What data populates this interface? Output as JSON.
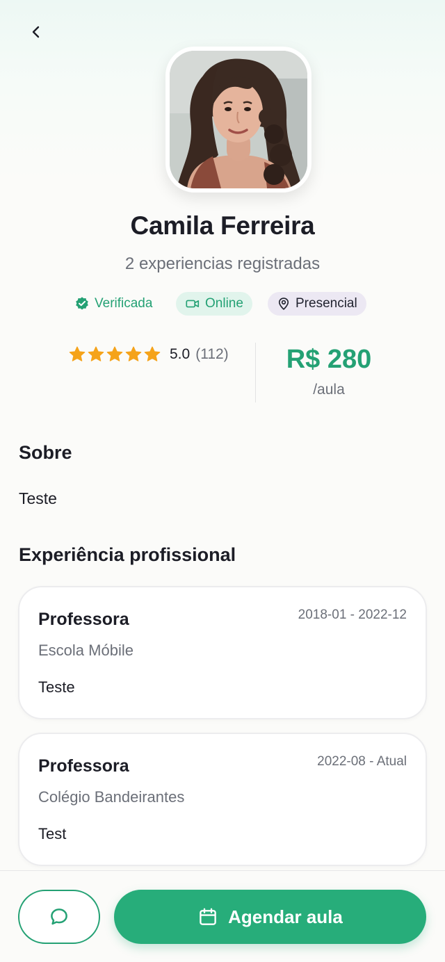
{
  "profile": {
    "name": "Camila Ferreira",
    "experience_count_text": "2 experiencias registradas",
    "badges": {
      "verified": "Verificada",
      "online": "Online",
      "presencial": "Presencial"
    },
    "rating": {
      "stars": 5,
      "value": "5.0",
      "count": "(112)"
    },
    "price": {
      "amount": "R$ 280",
      "unit": "/aula"
    }
  },
  "about": {
    "title": "Sobre",
    "text": "Teste"
  },
  "experience": {
    "title": "Experiência profissional",
    "items": [
      {
        "role": "Professora",
        "dates": "2018-01 - 2022-12",
        "company": "Escola Móbile",
        "description": "Teste"
      },
      {
        "role": "Professora",
        "dates": "2022-08 - Atual",
        "company": "Colégio Bandeirantes",
        "description": "Test"
      }
    ]
  },
  "actions": {
    "book_label": "Agendar aula"
  },
  "icons": {
    "back": "chevron-left-icon",
    "verified": "verified-check-icon",
    "online": "video-camera-icon",
    "presencial": "map-pin-icon",
    "star": "star-icon",
    "chat": "chat-bubble-icon",
    "calendar": "calendar-icon"
  },
  "colors": {
    "accent": "#27ad7a",
    "accent_text": "#24a174",
    "star": "#f5a31a",
    "online_bg": "#e1f4ec",
    "presencial_bg": "#ece8f3"
  }
}
